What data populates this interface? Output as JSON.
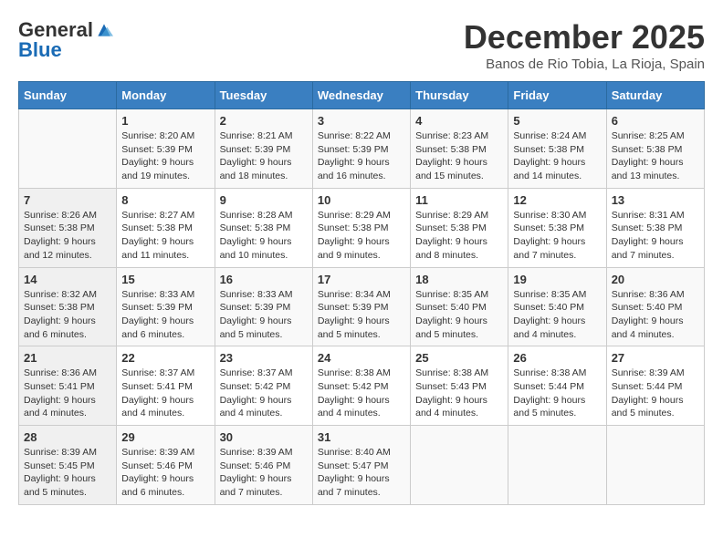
{
  "logo": {
    "general": "General",
    "blue": "Blue"
  },
  "header": {
    "month": "December 2025",
    "location": "Banos de Rio Tobia, La Rioja, Spain"
  },
  "weekdays": [
    "Sunday",
    "Monday",
    "Tuesday",
    "Wednesday",
    "Thursday",
    "Friday",
    "Saturday"
  ],
  "weeks": [
    [
      {
        "day": "",
        "info": ""
      },
      {
        "day": "1",
        "info": "Sunrise: 8:20 AM\nSunset: 5:39 PM\nDaylight: 9 hours\nand 19 minutes."
      },
      {
        "day": "2",
        "info": "Sunrise: 8:21 AM\nSunset: 5:39 PM\nDaylight: 9 hours\nand 18 minutes."
      },
      {
        "day": "3",
        "info": "Sunrise: 8:22 AM\nSunset: 5:39 PM\nDaylight: 9 hours\nand 16 minutes."
      },
      {
        "day": "4",
        "info": "Sunrise: 8:23 AM\nSunset: 5:38 PM\nDaylight: 9 hours\nand 15 minutes."
      },
      {
        "day": "5",
        "info": "Sunrise: 8:24 AM\nSunset: 5:38 PM\nDaylight: 9 hours\nand 14 minutes."
      },
      {
        "day": "6",
        "info": "Sunrise: 8:25 AM\nSunset: 5:38 PM\nDaylight: 9 hours\nand 13 minutes."
      }
    ],
    [
      {
        "day": "7",
        "info": "Sunrise: 8:26 AM\nSunset: 5:38 PM\nDaylight: 9 hours\nand 12 minutes."
      },
      {
        "day": "8",
        "info": "Sunrise: 8:27 AM\nSunset: 5:38 PM\nDaylight: 9 hours\nand 11 minutes."
      },
      {
        "day": "9",
        "info": "Sunrise: 8:28 AM\nSunset: 5:38 PM\nDaylight: 9 hours\nand 10 minutes."
      },
      {
        "day": "10",
        "info": "Sunrise: 8:29 AM\nSunset: 5:38 PM\nDaylight: 9 hours\nand 9 minutes."
      },
      {
        "day": "11",
        "info": "Sunrise: 8:29 AM\nSunset: 5:38 PM\nDaylight: 9 hours\nand 8 minutes."
      },
      {
        "day": "12",
        "info": "Sunrise: 8:30 AM\nSunset: 5:38 PM\nDaylight: 9 hours\nand 7 minutes."
      },
      {
        "day": "13",
        "info": "Sunrise: 8:31 AM\nSunset: 5:38 PM\nDaylight: 9 hours\nand 7 minutes."
      }
    ],
    [
      {
        "day": "14",
        "info": "Sunrise: 8:32 AM\nSunset: 5:38 PM\nDaylight: 9 hours\nand 6 minutes."
      },
      {
        "day": "15",
        "info": "Sunrise: 8:33 AM\nSunset: 5:39 PM\nDaylight: 9 hours\nand 6 minutes."
      },
      {
        "day": "16",
        "info": "Sunrise: 8:33 AM\nSunset: 5:39 PM\nDaylight: 9 hours\nand 5 minutes."
      },
      {
        "day": "17",
        "info": "Sunrise: 8:34 AM\nSunset: 5:39 PM\nDaylight: 9 hours\nand 5 minutes."
      },
      {
        "day": "18",
        "info": "Sunrise: 8:35 AM\nSunset: 5:40 PM\nDaylight: 9 hours\nand 5 minutes."
      },
      {
        "day": "19",
        "info": "Sunrise: 8:35 AM\nSunset: 5:40 PM\nDaylight: 9 hours\nand 4 minutes."
      },
      {
        "day": "20",
        "info": "Sunrise: 8:36 AM\nSunset: 5:40 PM\nDaylight: 9 hours\nand 4 minutes."
      }
    ],
    [
      {
        "day": "21",
        "info": "Sunrise: 8:36 AM\nSunset: 5:41 PM\nDaylight: 9 hours\nand 4 minutes."
      },
      {
        "day": "22",
        "info": "Sunrise: 8:37 AM\nSunset: 5:41 PM\nDaylight: 9 hours\nand 4 minutes."
      },
      {
        "day": "23",
        "info": "Sunrise: 8:37 AM\nSunset: 5:42 PM\nDaylight: 9 hours\nand 4 minutes."
      },
      {
        "day": "24",
        "info": "Sunrise: 8:38 AM\nSunset: 5:42 PM\nDaylight: 9 hours\nand 4 minutes."
      },
      {
        "day": "25",
        "info": "Sunrise: 8:38 AM\nSunset: 5:43 PM\nDaylight: 9 hours\nand 4 minutes."
      },
      {
        "day": "26",
        "info": "Sunrise: 8:38 AM\nSunset: 5:44 PM\nDaylight: 9 hours\nand 5 minutes."
      },
      {
        "day": "27",
        "info": "Sunrise: 8:39 AM\nSunset: 5:44 PM\nDaylight: 9 hours\nand 5 minutes."
      }
    ],
    [
      {
        "day": "28",
        "info": "Sunrise: 8:39 AM\nSunset: 5:45 PM\nDaylight: 9 hours\nand 5 minutes."
      },
      {
        "day": "29",
        "info": "Sunrise: 8:39 AM\nSunset: 5:46 PM\nDaylight: 9 hours\nand 6 minutes."
      },
      {
        "day": "30",
        "info": "Sunrise: 8:39 AM\nSunset: 5:46 PM\nDaylight: 9 hours\nand 7 minutes."
      },
      {
        "day": "31",
        "info": "Sunrise: 8:40 AM\nSunset: 5:47 PM\nDaylight: 9 hours\nand 7 minutes."
      },
      {
        "day": "",
        "info": ""
      },
      {
        "day": "",
        "info": ""
      },
      {
        "day": "",
        "info": ""
      }
    ]
  ]
}
